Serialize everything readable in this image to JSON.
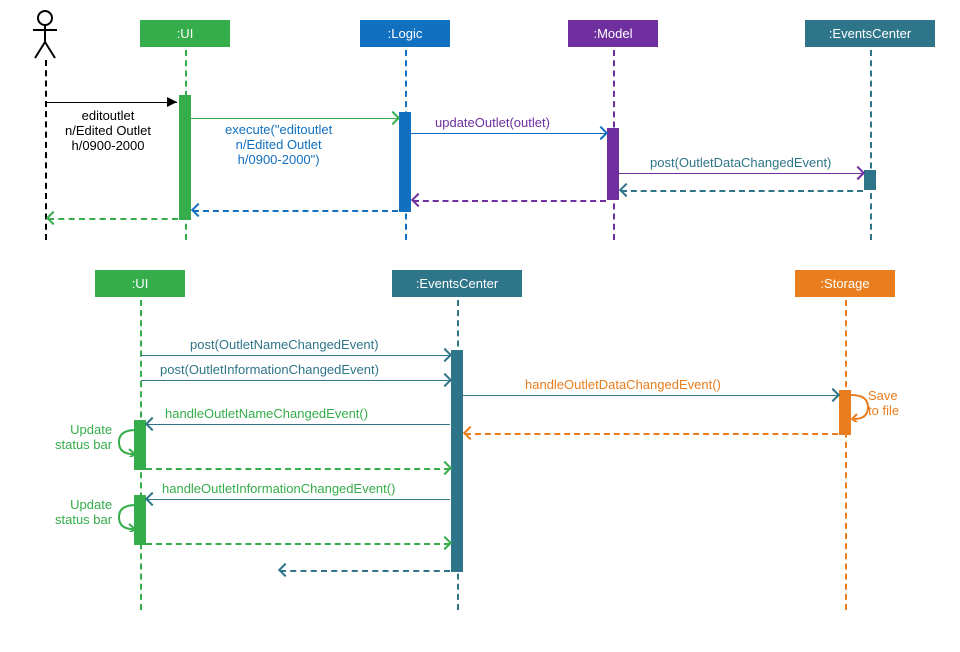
{
  "top": {
    "actor": "Actor",
    "ui": ":UI",
    "logic": ":Logic",
    "model": ":Model",
    "ec": ":EventsCenter",
    "cmd1": "editoutlet",
    "cmd2": "n/Edited Outlet",
    "cmd3": "h/0900-2000",
    "exec1": "execute(\"editoutlet",
    "exec2": "n/Edited Outlet",
    "exec3": "h/0900-2000\")",
    "updateOutlet": "updateOutlet(outlet)",
    "postEvent": "post(OutletDataChangedEvent)"
  },
  "bottom": {
    "ui": ":UI",
    "ec": ":EventsCenter",
    "storage": ":Storage",
    "postName": "post(OutletNameChangedEvent)",
    "postInfo": "post(OutletInformationChangedEvent)",
    "handleData": "handleOutletDataChangedEvent()",
    "save1": "Save",
    "save2": "to file",
    "handleName": "handleOutletNameChangedEvent()",
    "handleInfo": "handleOutletInformationChangedEvent()",
    "update1": "Update",
    "update2": "status bar"
  },
  "colors": {
    "green": "#35AD4A",
    "blue": "#1270C0",
    "purple": "#6F2F9F",
    "teal": "#2E7589",
    "orange": "#EA7D1E",
    "black": "#000000"
  }
}
